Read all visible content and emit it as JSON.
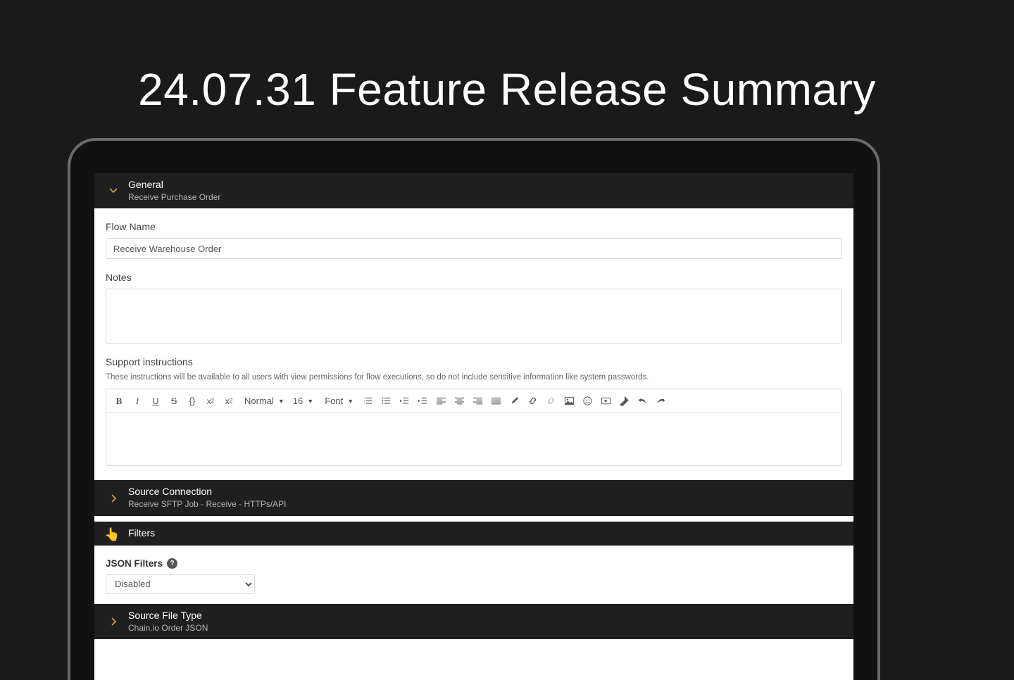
{
  "headline": "24.07.31 Feature Release Summary",
  "sections": {
    "general": {
      "title": "General",
      "subtitle": "Receive Purchase Order"
    },
    "source_connection": {
      "title": "Source Connection",
      "subtitle": "Receive SFTP Job - Receive - HTTPs/API"
    },
    "filters": {
      "title": "Filters"
    },
    "source_file_type": {
      "title": "Source File Type",
      "subtitle": "Chain.io Order JSON"
    }
  },
  "fields": {
    "flow_name_label": "Flow Name",
    "flow_name_value": "Receive Warehouse Order",
    "notes_label": "Notes",
    "support_label": "Support instructions",
    "support_helper": "These instructions will be available to all users with view permissions for flow executions, so do not include sensitive information like system passwords.",
    "json_filters_label": "JSON Filters",
    "json_filters_value": "Disabled"
  },
  "toolbar": {
    "style_normal": "Normal",
    "font_size": "16",
    "font_family": "Font"
  }
}
